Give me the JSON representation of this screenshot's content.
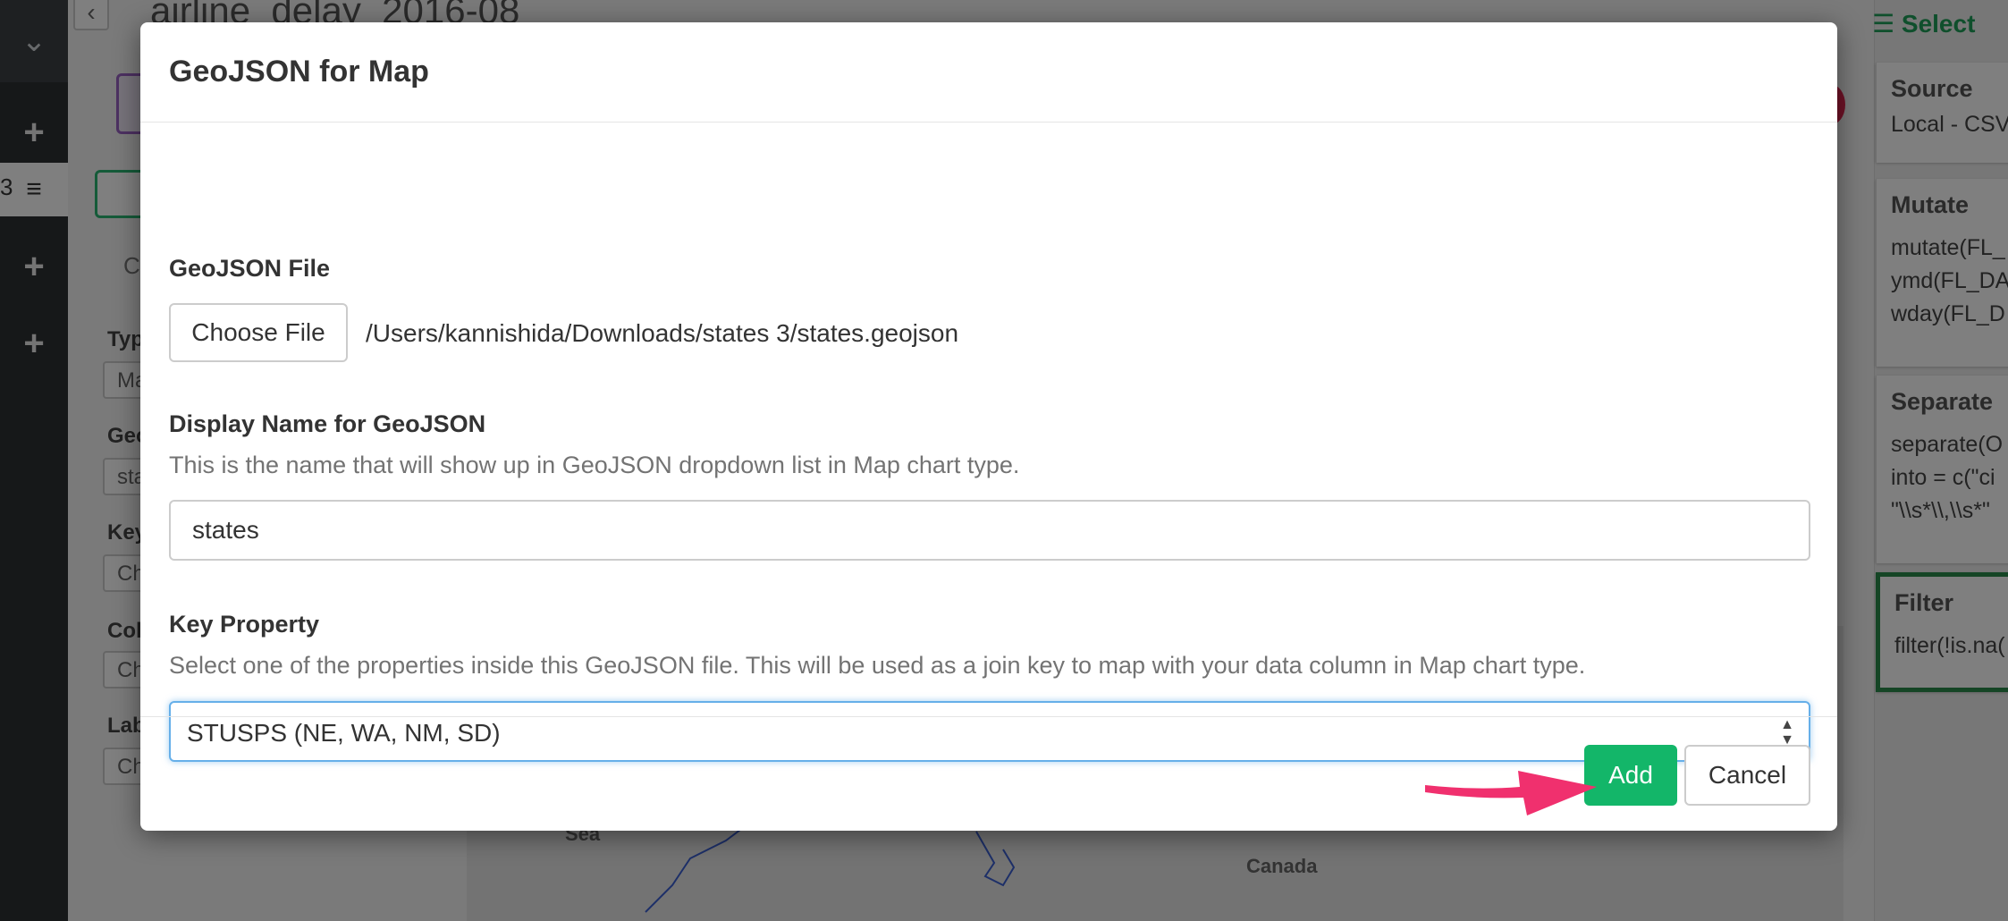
{
  "app": {
    "page_title": "airline_delay_2016-08",
    "sidebar_fields": [
      {
        "label": "Typ",
        "value": "Ma"
      },
      {
        "label": "Geo",
        "value": "sta"
      },
      {
        "label": "Key",
        "value": "Ch"
      },
      {
        "label": "Col",
        "value": "Ch"
      },
      {
        "label": "Lab",
        "value": "Ch"
      }
    ],
    "sidebar_tab_letter": "C",
    "rail_badge": "3",
    "map_labels": {
      "sea": "Sea",
      "country": "Canada"
    }
  },
  "steps_panel": {
    "header": "Select",
    "steps": [
      {
        "title": "Source",
        "lines": [
          "Local - CSV"
        ]
      },
      {
        "title": "Mutate",
        "lines": [
          "mutate(FL_",
          "ymd(FL_DA",
          "wday(FL_D"
        ]
      },
      {
        "title": "Separate",
        "lines": [
          "separate(O",
          "into = c(\"ci",
          "\"\\\\s*\\\\,\\\\s*\""
        ]
      },
      {
        "title": "Filter",
        "lines": [
          "filter(!is.na("
        ]
      }
    ]
  },
  "modal": {
    "title": "GeoJSON for Map",
    "geojson_file": {
      "label": "GeoJSON File",
      "button_label": "Choose File",
      "path": "/Users/kannishida/Downloads/states 3/states.geojson"
    },
    "display_name": {
      "label": "Display Name for GeoJSON",
      "help": "This is the name that will show up in GeoJSON dropdown list in Map chart type.",
      "value": "states"
    },
    "key_property": {
      "label": "Key Property",
      "help": "Select one of the properties inside this GeoJSON file. This will be used as a join key to map with your data column in Map chart type.",
      "selected": "STUSPS (NE, WA, NM, SD)"
    },
    "buttons": {
      "add": "Add",
      "cancel": "Cancel"
    }
  },
  "colors": {
    "primary": "#13b669",
    "focus": "#66afe9",
    "arrow": "#f0306e"
  }
}
